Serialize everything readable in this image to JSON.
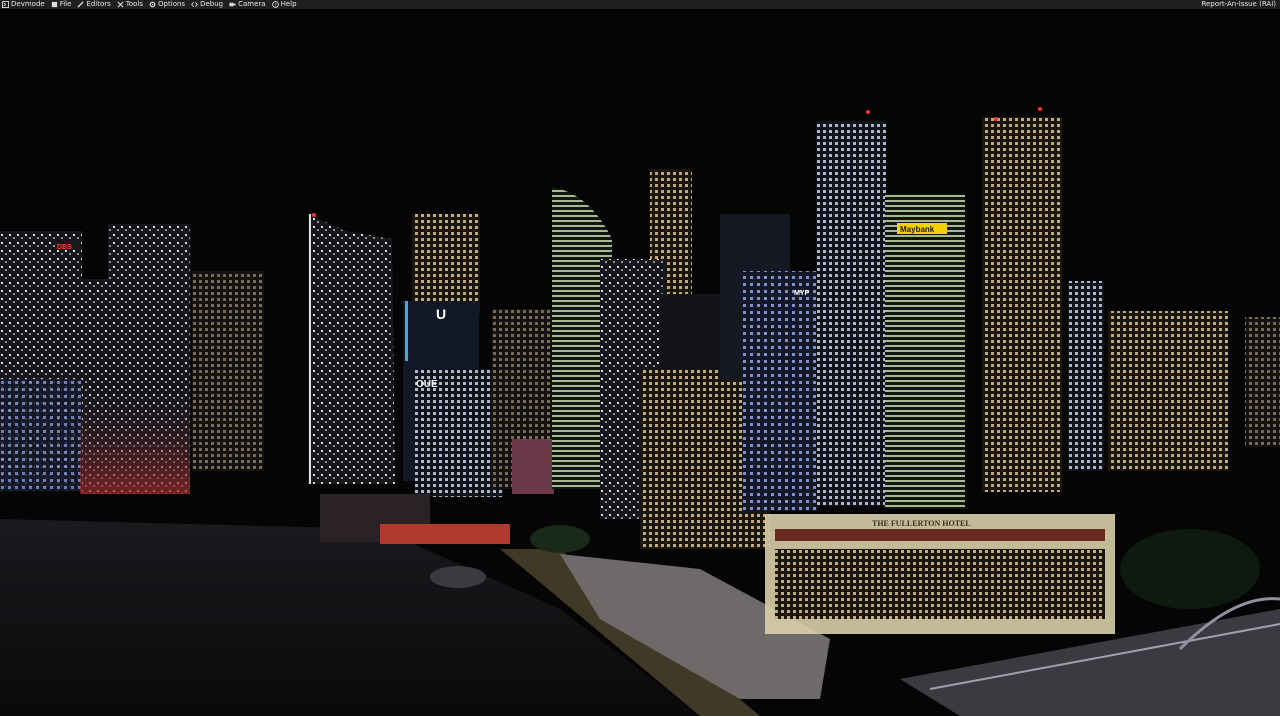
{
  "menubar": {
    "items": [
      {
        "label": "Devmode",
        "icon": "devmode-icon"
      },
      {
        "label": "File",
        "icon": "file-icon"
      },
      {
        "label": "Editors",
        "icon": "pencil-icon"
      },
      {
        "label": "Tools",
        "icon": "tools-icon"
      },
      {
        "label": "Options",
        "icon": "gear-icon"
      },
      {
        "label": "Debug",
        "icon": "code-icon"
      },
      {
        "label": "Camera",
        "icon": "camera-icon"
      },
      {
        "label": "Help",
        "icon": "help-icon"
      }
    ],
    "report_label": "Report-An-Issue (RAI)"
  },
  "scene": {
    "signs": {
      "dbs": "DBS",
      "uob": "U",
      "oue": "OUE",
      "myp": "MYP",
      "maybank": "Maybank",
      "hotel": "THE FULLERTON HOTEL"
    },
    "colors": {
      "sky": "#050505",
      "water": "#0d0d0f",
      "window_warm": "#e8c98a",
      "window_cool": "#b8c8e8",
      "maybank_sign": "#f5d000",
      "dbs_sign": "#d9251c",
      "hotel_facade": "#d8cfa8"
    }
  }
}
